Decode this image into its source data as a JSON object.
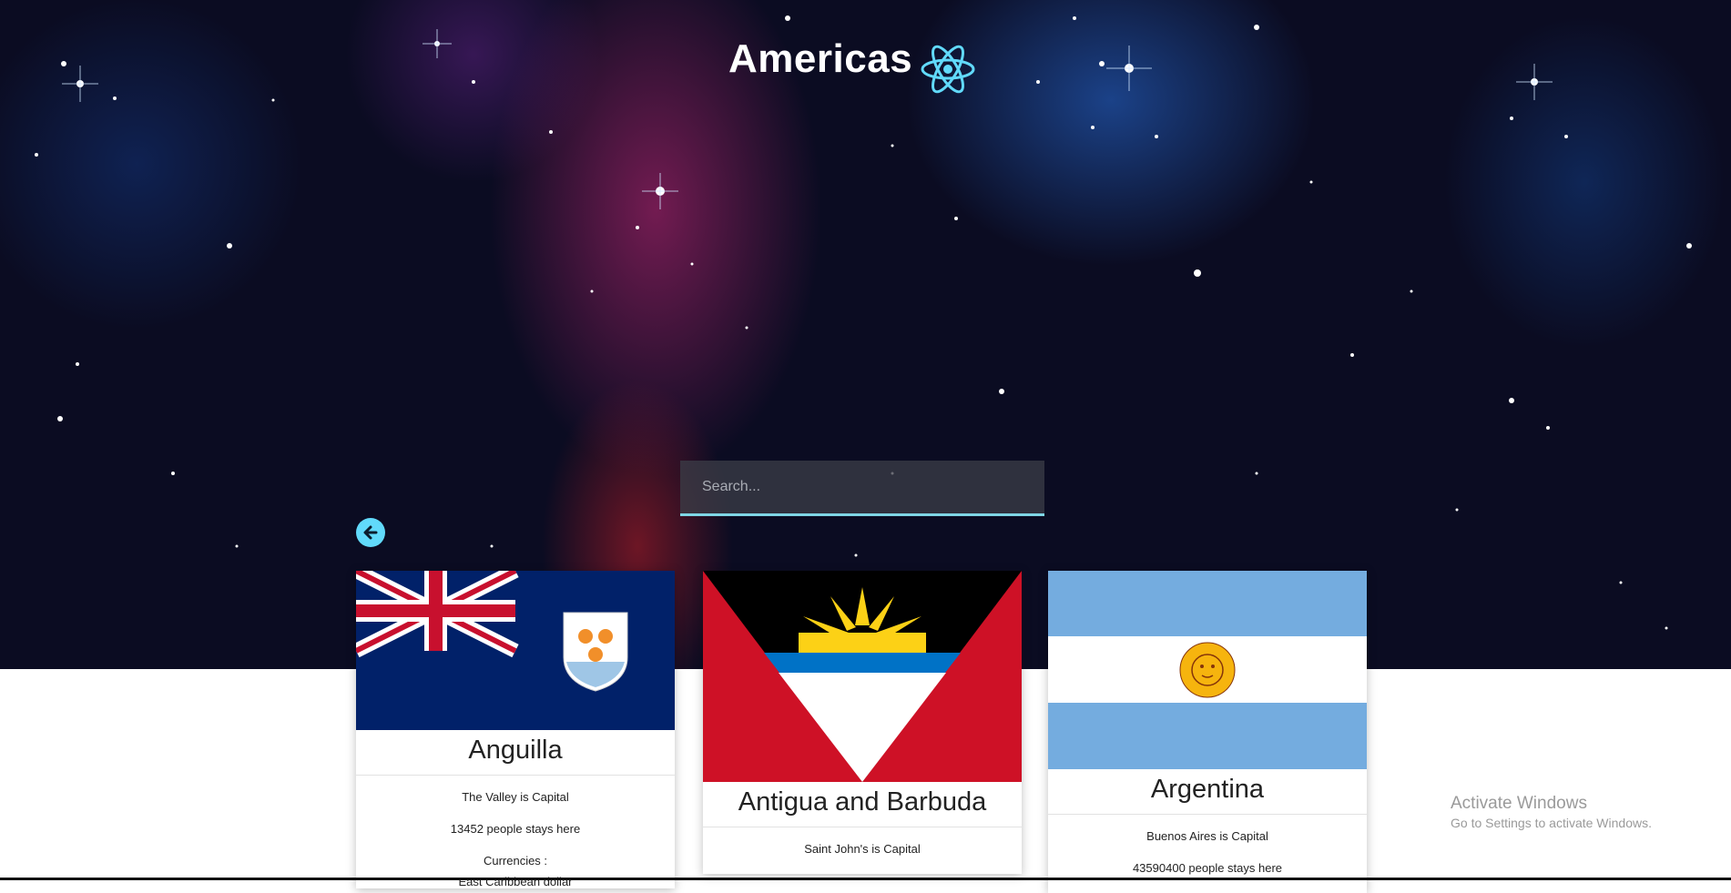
{
  "header": {
    "title": "Americas",
    "logo_icon": "react-atom-icon",
    "accent_color": "#61dafb"
  },
  "search": {
    "placeholder": "Search..."
  },
  "back_button": {
    "icon": "arrow-left-icon"
  },
  "countries": [
    {
      "name": "Anguilla",
      "capital_text": "The Valley is Capital",
      "population_text": "13452 people stays here",
      "currencies_label": "Currencies :",
      "currency_text": "East Caribbean dollar"
    },
    {
      "name": "Antigua and Barbuda",
      "capital_text": "Saint John's is Capital"
    },
    {
      "name": "Argentina",
      "capital_text": "Buenos Aires is Capital",
      "population_text": "43590400 people stays here"
    }
  ],
  "watermark": {
    "line1": "Activate Windows",
    "line2": "Go to Settings to activate Windows."
  }
}
